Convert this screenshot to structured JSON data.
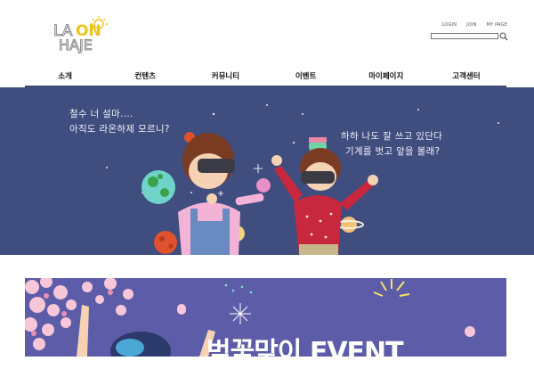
{
  "header": {
    "logo": {
      "line1_a": "LA",
      "line1_b": "ON",
      "line2": "HAJE"
    },
    "util_links": [
      "LOGIN",
      "JOIN",
      "MY PAGE"
    ],
    "search": {
      "placeholder": ""
    }
  },
  "nav": {
    "items": [
      "소개",
      "컨텐츠",
      "커뮤니티",
      "이벤트",
      "마이페이지",
      "고객센터"
    ]
  },
  "hero": {
    "left_line1": "철수 너 설마....",
    "left_line2": "아직도 라온하제 모르니?",
    "right_line1": "하하 나도 잘 쓰고 있단다",
    "right_line2": "기계를 벗고 앞을 볼래?"
  },
  "event_banner": {
    "title": "벚꽃맞이 EVENT"
  },
  "colors": {
    "hero_bg": "#3f4d7f",
    "banner_bg": "#5c5ca8",
    "logo_yellow": "#f0c419",
    "logo_gray": "#8a8a8a",
    "nav_underline": "#3d4a72"
  }
}
